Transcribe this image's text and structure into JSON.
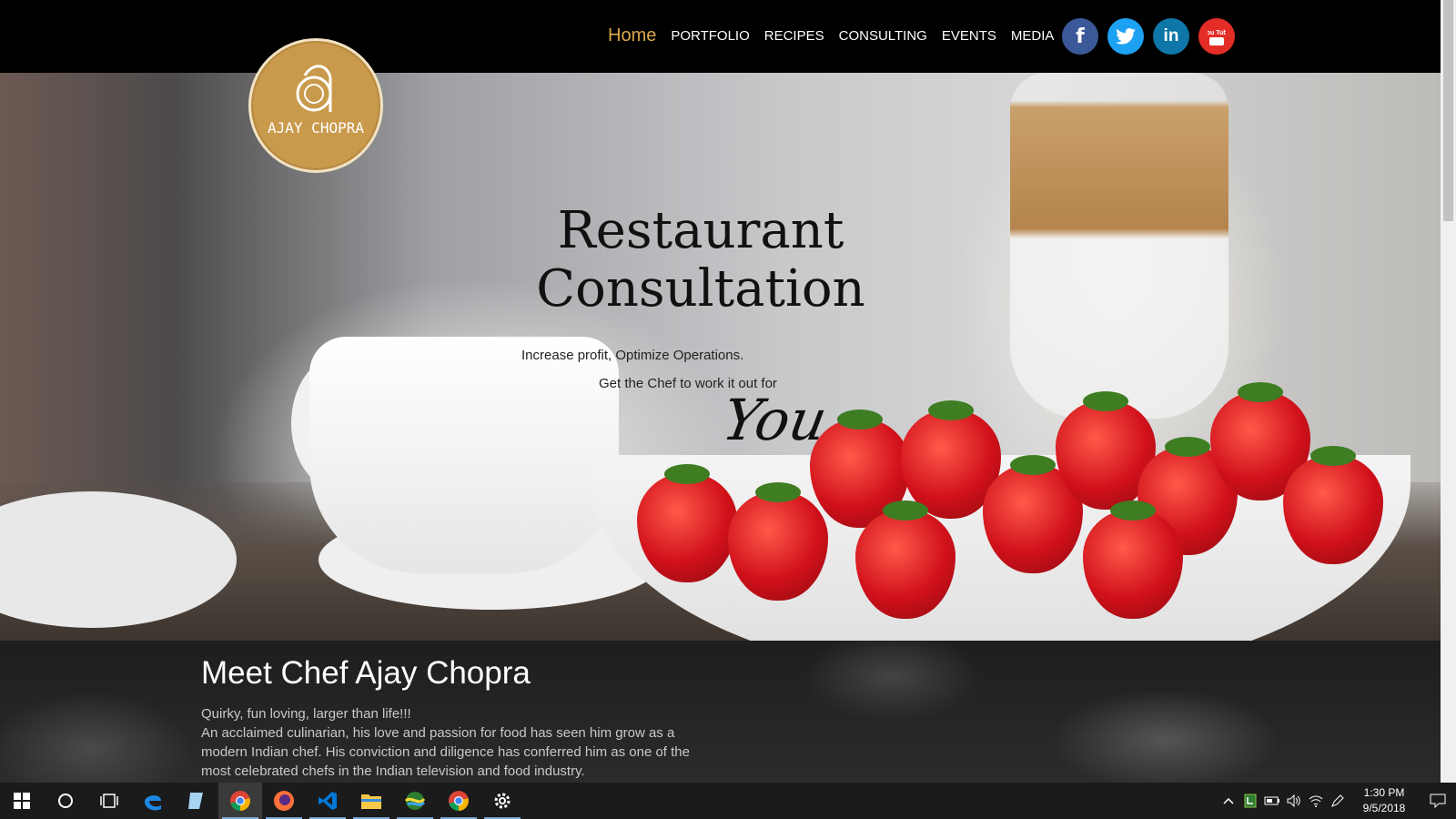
{
  "nav": {
    "items": [
      {
        "label": "Home",
        "active": true
      },
      {
        "label": "PORTFOLIO",
        "active": false
      },
      {
        "label": "RECIPES",
        "active": false
      },
      {
        "label": "CONSULTING",
        "active": false
      },
      {
        "label": "EVENTS",
        "active": false
      },
      {
        "label": "MEDIA",
        "active": false
      }
    ],
    "active_color": "#d9a74a",
    "socials": [
      {
        "name": "facebook-icon",
        "glyph": "f",
        "color": "#3b5998"
      },
      {
        "name": "twitter-icon",
        "color": "#1da1f2"
      },
      {
        "name": "linkedin-icon",
        "glyph": "in",
        "color": "#0e76a8"
      },
      {
        "name": "youtube-icon",
        "glyph": "You Tube",
        "color": "#e52d27"
      }
    ]
  },
  "logo": {
    "text": "AJAY CHOPRA",
    "color": "#c99a4c"
  },
  "hero": {
    "title_line1": "Restaurant",
    "title_line2": "Consultation",
    "subtitle1": "Increase profit, Optimize Operations.",
    "subtitle2": "Get the Chef to work it out for",
    "script_word": "You"
  },
  "about": {
    "title": "Meet Chef Ajay Chopra",
    "tagline": "Quirky, fun loving, larger than life!!!",
    "body": "An acclaimed culinarian, his love and passion for food has seen him grow as a modern Indian chef. His conviction and diligence has conferred him as one of the most celebrated chefs in the Indian television and food industry."
  },
  "taskbar": {
    "apps": [
      "start-icon",
      "search-icon",
      "task-view-icon",
      "edge-icon",
      "notepad-icon",
      "chrome-icon",
      "firefox-icon",
      "vscode-icon",
      "file-explorer-icon",
      "maps-icon",
      "chrome-icon",
      "settings-icon"
    ],
    "clock_time": "1:30 PM",
    "clock_date": "9/5/2018"
  }
}
